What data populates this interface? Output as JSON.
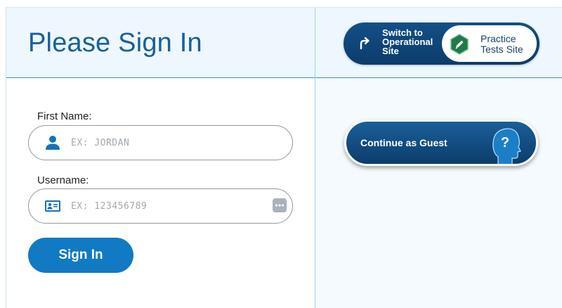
{
  "header": {
    "title": "Please Sign In"
  },
  "site_toggle": {
    "operational_label": "Switch to Operational Site",
    "operational_lines": [
      "Switch to",
      "Operational",
      "Site"
    ],
    "practice_lines": [
      "Practice",
      "Tests Site"
    ]
  },
  "form": {
    "first_name": {
      "label": "First Name:",
      "placeholder": "EX: JORDAN",
      "value": ""
    },
    "username": {
      "label": "Username:",
      "placeholder": "EX: 123456789",
      "value": ""
    },
    "sign_in_label": "Sign In"
  },
  "guest": {
    "label": "Continue as Guest",
    "icon_glyph": "?"
  },
  "colors": {
    "title": "#17609c",
    "primary_button": "#117ac2",
    "navy": "#0c3c6b",
    "practice_badge": "#1e7a47"
  },
  "icons": {
    "switch": "redo-arrow-icon",
    "practice": "pencil-hexagon-icon",
    "first_name": "person-icon",
    "username": "id-card-icon",
    "reveal": "ellipsis-icon",
    "guest": "head-question-icon"
  }
}
